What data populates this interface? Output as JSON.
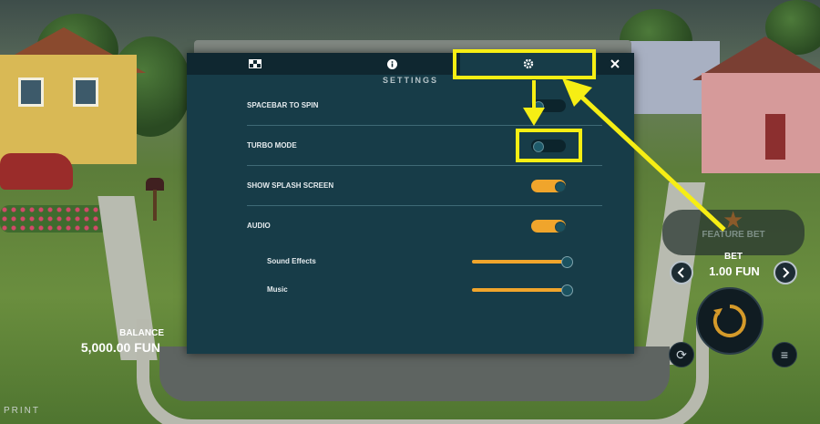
{
  "tabs": [
    {
      "icon": "paytable-icon"
    },
    {
      "icon": "info-icon"
    },
    {
      "icon": "gear-icon",
      "active": true
    }
  ],
  "close_icon": "close-icon",
  "settings": {
    "title": "SETTINGS",
    "rows": [
      {
        "label": "SPACEBAR TO SPIN",
        "on": false
      },
      {
        "label": "TURBO MODE",
        "on": false
      },
      {
        "label": "SHOW SPLASH SCREEN",
        "on": true
      },
      {
        "label": "AUDIO",
        "on": true
      }
    ],
    "sliders": [
      {
        "label": "Sound Effects",
        "level": 1.0
      },
      {
        "label": "Music",
        "level": 1.0
      }
    ]
  },
  "hud": {
    "feature_bet_label": "FEATURE BET",
    "bet_label": "BET",
    "bet_value": "1.00 FUN",
    "balance_label": "BALANCE",
    "balance_value": "5,000.00 FUN",
    "print_label": "PRINT"
  },
  "colors": {
    "highlight": "#f6ee14",
    "toggle_on": "#f0a52c",
    "panel_bg": "#173c48"
  }
}
